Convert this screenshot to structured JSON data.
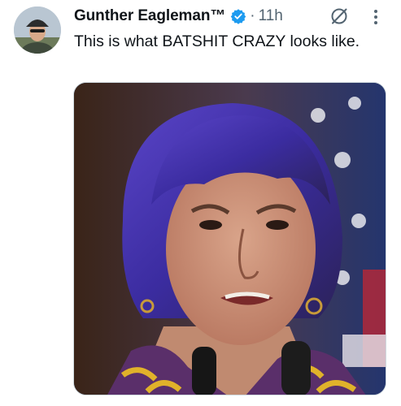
{
  "tweet": {
    "author_name": "Gunther Eagleman™",
    "separator": "·",
    "timestamp": "11h",
    "text": "This is what BATSHIT CRAZY looks like."
  },
  "icons": {
    "verified": "verified-badge-icon",
    "grok": "grok-slash-icon",
    "more": "more-vertical-icon"
  },
  "colors": {
    "verified_blue": "#1d9bf0",
    "secondary_text": "#536471",
    "primary_text": "#0f1419"
  }
}
